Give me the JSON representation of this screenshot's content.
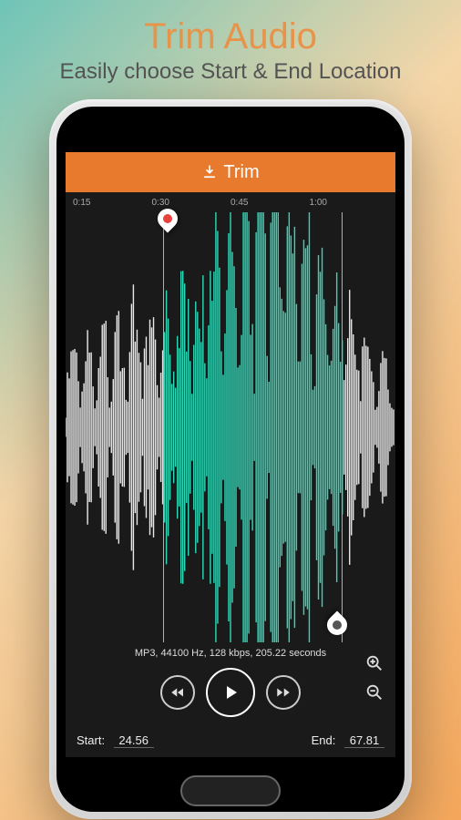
{
  "promo": {
    "title": "Trim Audio",
    "subtitle": "Easily choose Start & End Location"
  },
  "app_bar": {
    "trim_label": "Trim"
  },
  "timeline": {
    "ticks": [
      "0:15",
      "0:30",
      "0:45",
      "1:00"
    ]
  },
  "markers": {
    "start_color": "#e8433f",
    "end_color": "#555"
  },
  "audio_info": {
    "text": "MP3, 44100 Hz, 128 kbps, 205.22 seconds"
  },
  "footer": {
    "start_label": "Start:",
    "start_value": "24.56",
    "end_label": "End:",
    "end_value": "67.81"
  },
  "colors": {
    "accent": "#e87a2e",
    "waveform_selected": "#2fd9b8",
    "waveform_unselected": "#e8e8e8"
  }
}
